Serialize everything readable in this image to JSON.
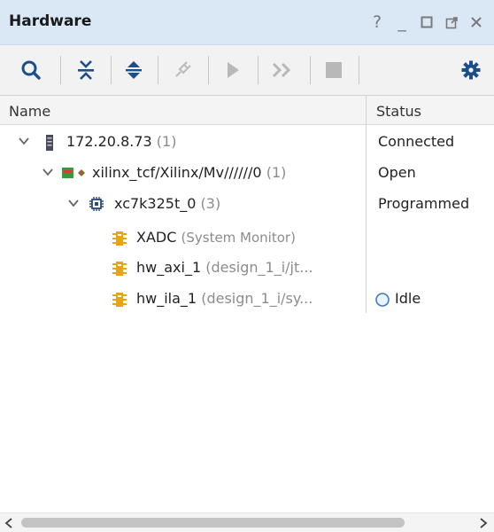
{
  "window": {
    "title": "Hardware",
    "help": "?",
    "minimize": "_"
  },
  "toolbar": {
    "icons": [
      "search-icon",
      "collapse-all-icon",
      "expand-all-icon",
      "auto-connect-icon",
      "run-trigger-icon",
      "run-immediate-icon",
      "stop-icon",
      "gear-icon"
    ]
  },
  "columns": {
    "name": "Name",
    "status": "Status"
  },
  "rows": [
    {
      "label": "172.20.8.73",
      "suffix": "(1)",
      "status": "Connected"
    },
    {
      "label": "xilinx_tcf/Xilinx/Mv//////0",
      "suffix": "(1)",
      "status": "Open"
    },
    {
      "label": "xc7k325t_0",
      "suffix": "(3)",
      "status": "Programmed"
    },
    {
      "label": "XADC",
      "suffix": "(System Monitor)",
      "status": ""
    },
    {
      "label": "hw_axi_1",
      "suffix": "(design_1_i/jt...",
      "status": ""
    },
    {
      "label": "hw_ila_1",
      "suffix": "(design_1_i/sy...",
      "status": "Idle"
    }
  ],
  "colors": {
    "title_bar": "#dae7f5",
    "accent_blue": "#1a4f8b",
    "debug_core": "#e8a317",
    "jtag_green": "#3a9a3a"
  }
}
